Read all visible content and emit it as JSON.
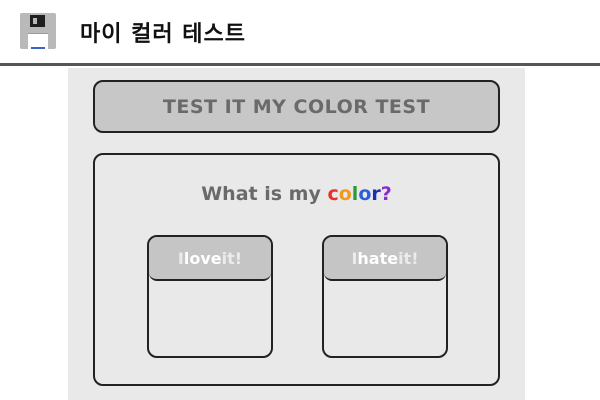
{
  "header": {
    "title": "마이 컬러 테스트",
    "icon": "floppy-disk-icon"
  },
  "banner": {
    "text": "TEST IT MY COLOR TEST"
  },
  "question": {
    "prefix": "What is my ",
    "word_letters": [
      "c",
      "o",
      "l",
      "o",
      "r"
    ],
    "suffix": "?",
    "letter_colors": [
      "#e8312a",
      "#f29a1c",
      "#2f9a3a",
      "#2f5fd6",
      "#1d2fb0"
    ],
    "suffix_color": "#8a2bd0"
  },
  "choices": {
    "love": {
      "part1": "I ",
      "emph": "love",
      "part2": " it!"
    },
    "hate": {
      "part1": "I ",
      "emph": "hate",
      "part2": " it!"
    }
  }
}
